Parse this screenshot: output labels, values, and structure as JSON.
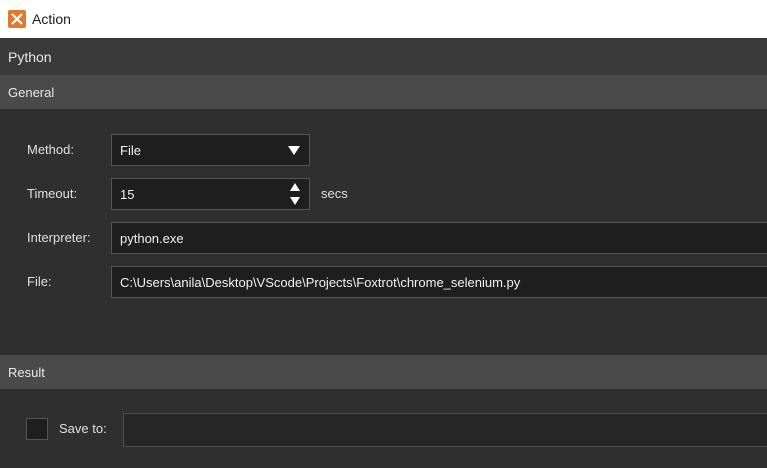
{
  "window": {
    "title": "Action",
    "icon": "action-app-icon"
  },
  "section": {
    "title": "Python"
  },
  "general": {
    "header": "General",
    "method_label": "Method:",
    "method_value": "File",
    "timeout_label": "Timeout:",
    "timeout_value": "15",
    "timeout_unit": "secs",
    "interpreter_label": "Interpreter:",
    "interpreter_value": "python.exe",
    "file_label": "File:",
    "file_value": "C:\\Users\\anila\\Desktop\\VScode\\Projects\\Foxtrot\\chrome_selenium.py"
  },
  "result": {
    "header": "Result",
    "save_to_label": "Save to:",
    "save_to_value": "",
    "save_to_checked": false
  },
  "colors": {
    "accent": "#e07a2c",
    "background": "#2b2b2b",
    "field_bg": "#1e1e1e"
  }
}
